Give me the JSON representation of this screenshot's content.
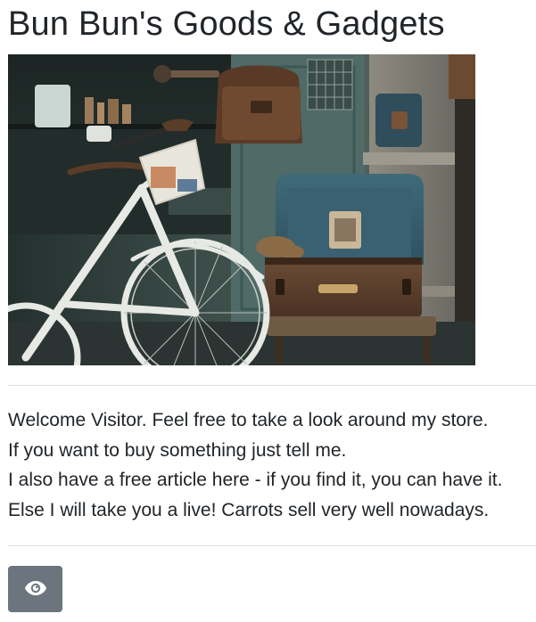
{
  "header": {
    "title": "Bun Bun's Goods & Gadgets"
  },
  "hero": {
    "subject": "shop window with white bicycle and open vintage suitcase"
  },
  "message": {
    "lines": [
      "Welcome Visitor. Feel free to take a look around my store.",
      "If you want to buy something just tell me.",
      "I also have a free article here - if you find it, you can have it.",
      "Else I will take you a live! Carrots sell very well nowadays."
    ]
  },
  "actions": {
    "look_button": {
      "icon": "eye-icon",
      "color": "#6c757d"
    }
  },
  "colors": {
    "text": "#212529",
    "divider": "#dee2e6",
    "button": "#6c757d"
  }
}
